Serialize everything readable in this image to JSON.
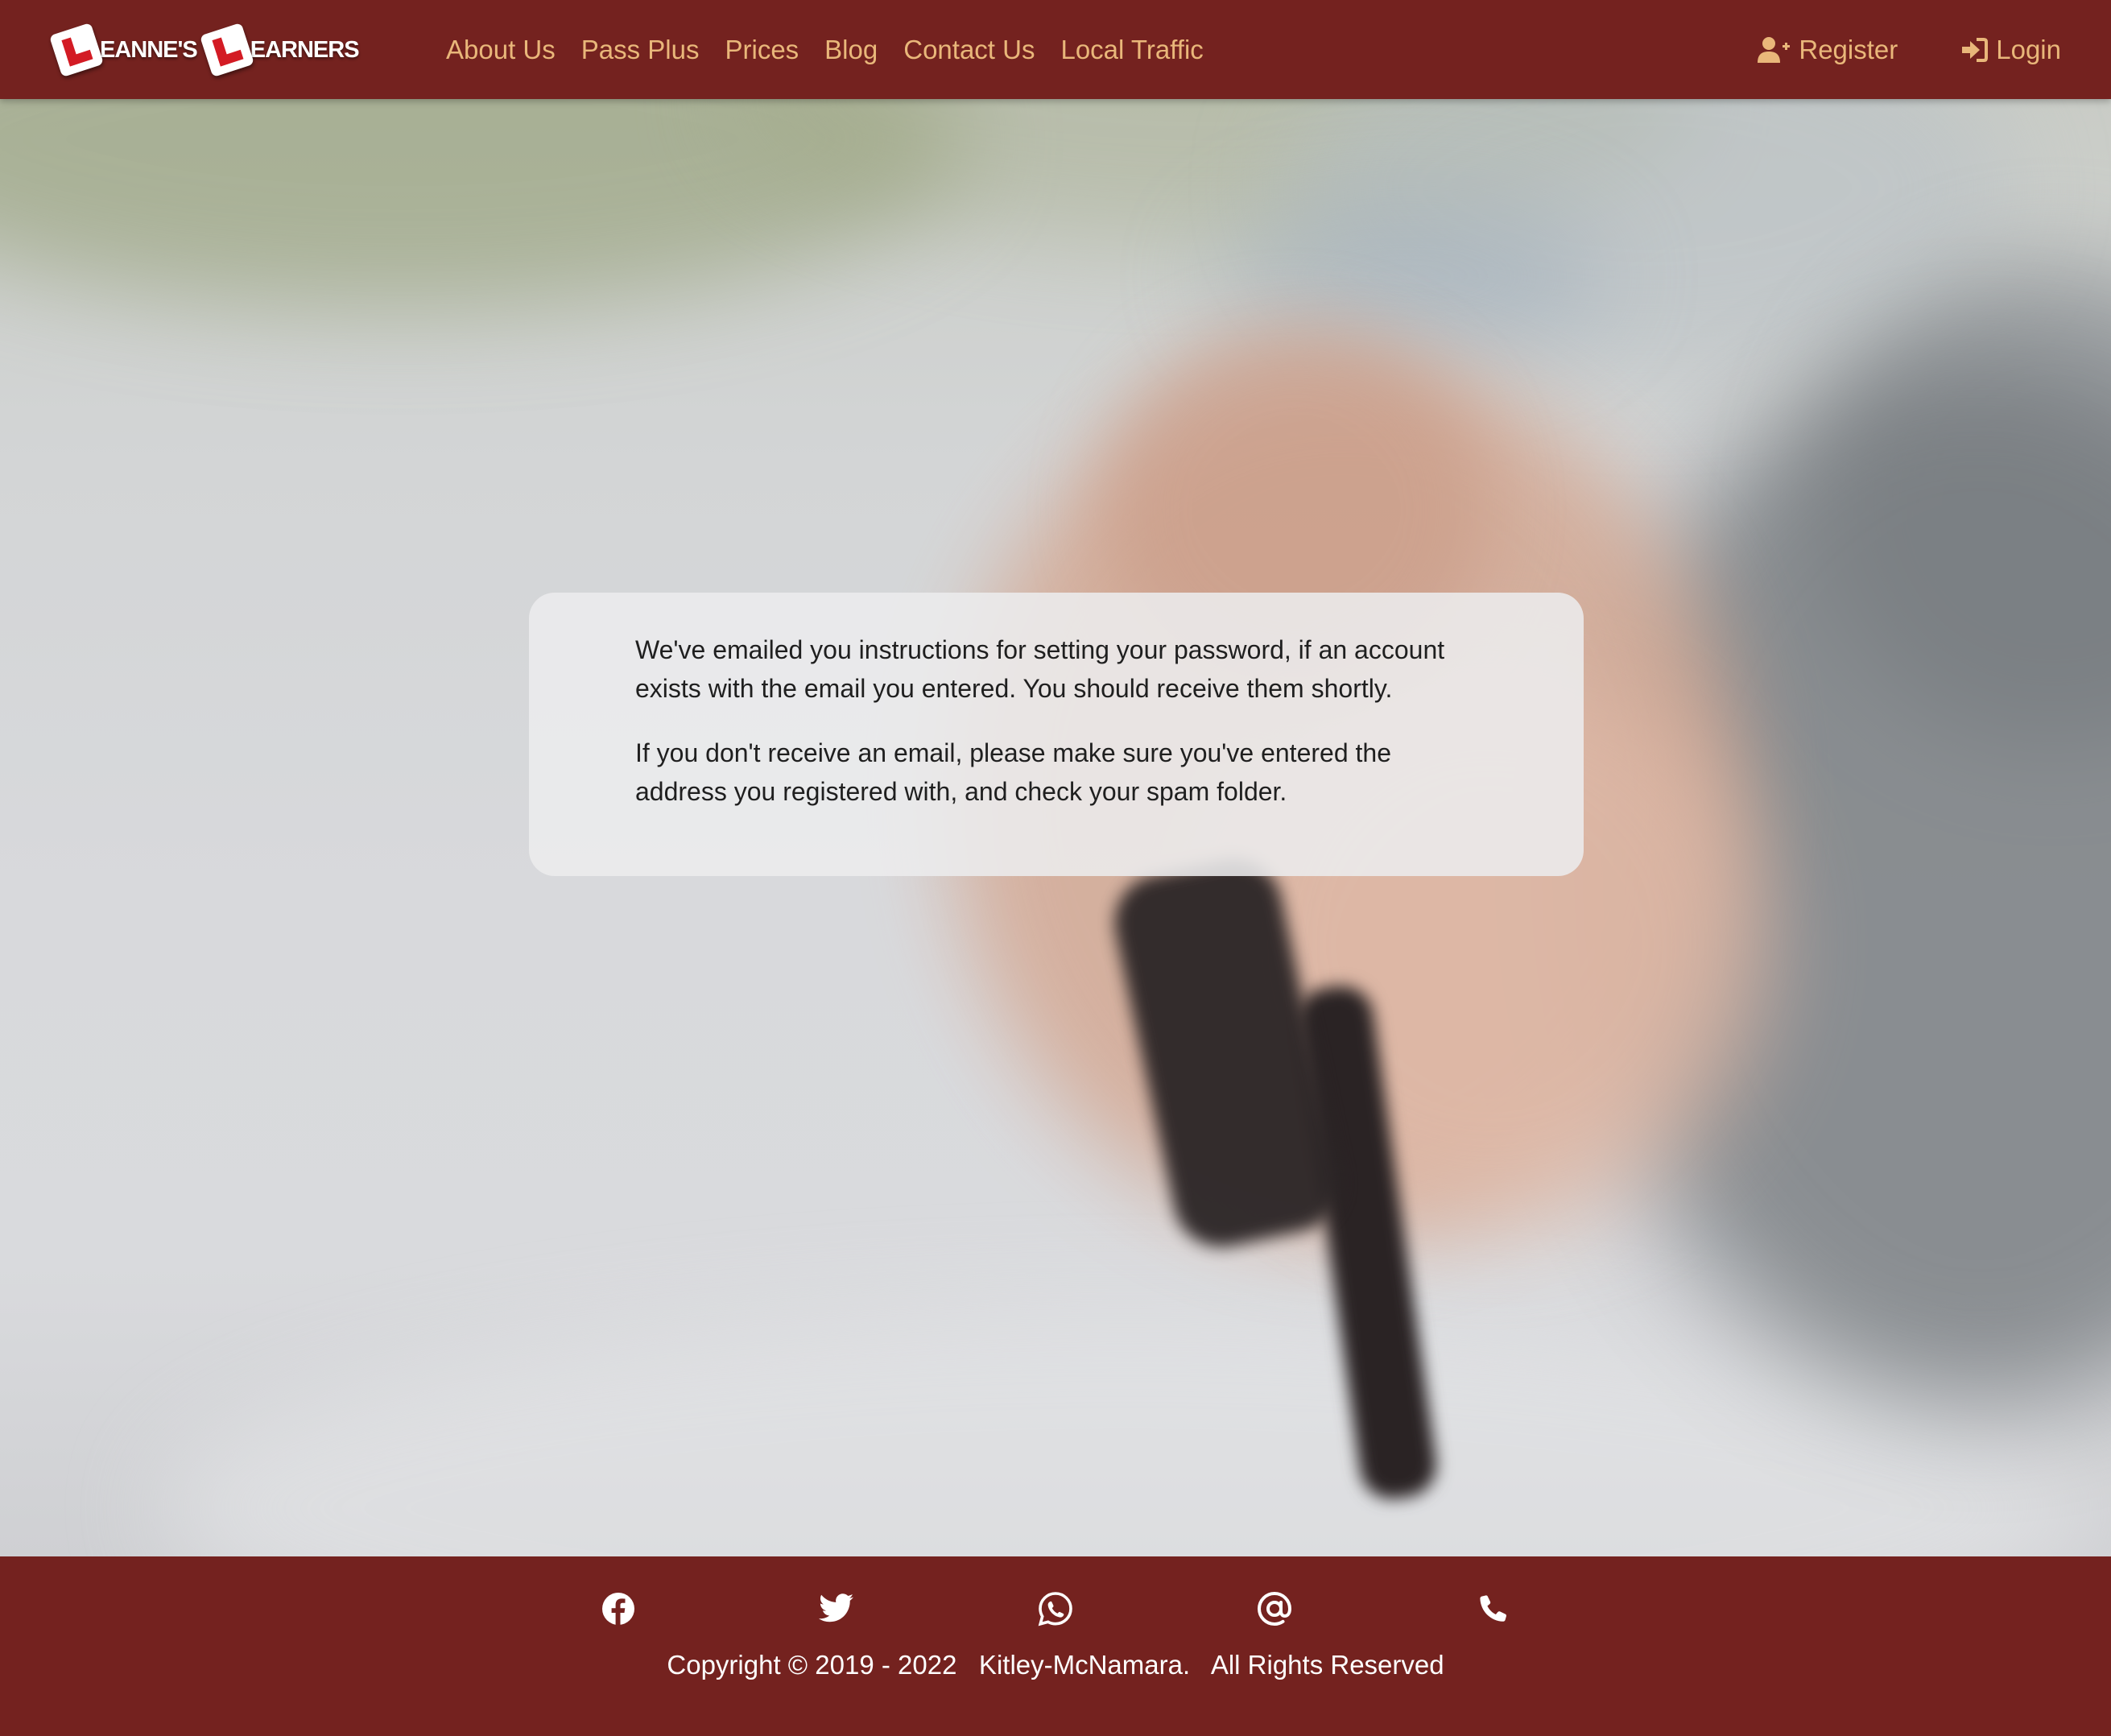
{
  "brand": {
    "part1": "EANNE'S",
    "part2": "EARNERS",
    "plate_letter": "L"
  },
  "nav": {
    "links": [
      "About Us",
      "Pass Plus",
      "Prices",
      "Blog",
      "Contact Us",
      "Local Traffic"
    ],
    "register_label": "Register",
    "login_label": "Login",
    "register_icon": "user-plus-icon",
    "login_icon": "sign-in-icon"
  },
  "message": {
    "paragraph1": "We've emailed you instructions for setting your password, if an account exists with the email you entered. You should receive them shortly.",
    "paragraph2": "If you don't receive an email, please make sure you've entered the address you registered with, and check your spam folder."
  },
  "footer": {
    "socials": [
      "facebook-icon",
      "twitter-icon",
      "whatsapp-icon",
      "at-sign-icon",
      "phone-icon"
    ],
    "copyright": "Copyright © 2019 - 2022   Kitley-McNamara.   All Rights Reserved"
  },
  "colors": {
    "brand_maroon": "#74221f",
    "nav_link": "#e9b77a",
    "plate_red": "#d31b24",
    "footer_text": "#ffffff"
  }
}
